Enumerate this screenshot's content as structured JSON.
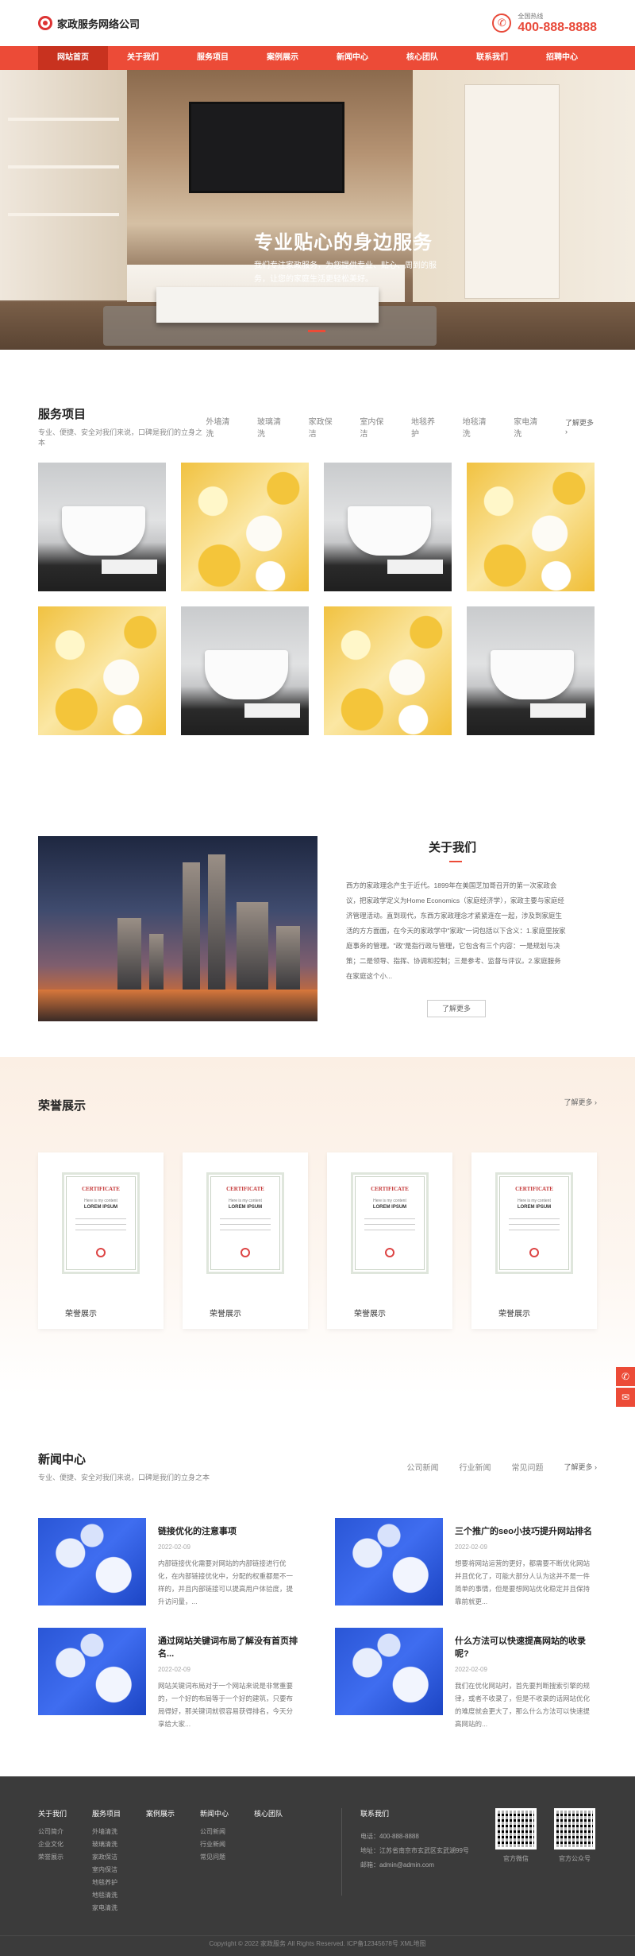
{
  "header": {
    "logo_text": "家政服务网络公司",
    "hotline_label": "全国热线",
    "hotline_number": "400-888-8888"
  },
  "nav": [
    "网站首页",
    "关于我们",
    "服务项目",
    "案例展示",
    "新闻中心",
    "核心团队",
    "联系我们",
    "招聘中心"
  ],
  "banner": {
    "title": "专业贴心的身边服务",
    "desc": "我们专注家政服务，为您提供专业、贴心、周到的服务，让您的家庭生活更轻松美好。"
  },
  "services": {
    "title": "服务项目",
    "subtitle": "专业、便捷、安全对我们来说，口碑是我们的立身之本",
    "tabs": [
      "外墙清洗",
      "玻璃清洗",
      "家政保洁",
      "室内保洁",
      "地毯养护",
      "地毯清洗",
      "家电清洗"
    ],
    "more": "了解更多 ›",
    "images": [
      "tub",
      "towel",
      "tub",
      "towel",
      "towel",
      "tub",
      "towel",
      "tub"
    ]
  },
  "about": {
    "title": "关于我们",
    "text": "西方的家政理念产生于近代。1899年在美国芝加哥召开的第一次家政会议，把家政学定义为Home Economics（家庭经济学），家政主要与家庭经济管理活动。直到现代，东西方家政理念才紧紧连在一起，涉及到家庭生活的方方面面，在今天的家政学中\"家政\"一词包括以下含义：1.家庭里按家庭事务的管理。\"政\"是指行政与管理，它包含有三个内容：一是规划与决策；二是领导、指挥、协调和控制；三是参考、监督与评议。2.家庭服务在家庭这个小...",
    "button": "了解更多"
  },
  "honor": {
    "title": "荣誉展示",
    "more": "了解更多 ›",
    "cert_title": "CERTIFICATE",
    "cert_sub": "Here is my content",
    "cert_name": "LOREM IPSUM",
    "items": [
      "荣誉展示",
      "荣誉展示",
      "荣誉展示",
      "荣誉展示"
    ]
  },
  "news": {
    "title": "新闻中心",
    "subtitle": "专业、便捷、安全对我们来说，口碑是我们的立身之本",
    "tabs": [
      "公司新闻",
      "行业新闻",
      "常见问题"
    ],
    "more": "了解更多 ›",
    "items": [
      {
        "title": "链接优化的注意事项",
        "date": "2022-02-09",
        "desc": "内部链接优化需要对网站的内部链接进行优化，在内部链接优化中，分配的权重都是不一样的，并且内部链接可以提高用户体验度，提升访问量，..."
      },
      {
        "title": "三个推广的seo小技巧提升网站排名",
        "date": "2022-02-09",
        "desc": "想要将网站运营的更好，都需要不断优化网站并且优化了，可能大部分人认为这并不是一件简单的事情，但是要想网站优化稳定并且保持靠前就更..."
      },
      {
        "title": "通过网站关键词布局了解没有首页排名...",
        "date": "2022-02-09",
        "desc": "网站关键词布局对于一个网站来说是非常重要的，一个好的布局等于一个好的建筑，只要布局得好，那关键词就很容易获得排名，今天分享给大家..."
      },
      {
        "title": "什么方法可以快速提高网站的收录呢?",
        "date": "2022-02-09",
        "desc": "我们在优化网站时，首先要判断搜索引擎的规律，或者不收录了，但是不收录的话网站优化的难度就会更大了，那么什么方法可以快速提高网站的..."
      }
    ]
  },
  "footer": {
    "cols": [
      {
        "title": "关于我们",
        "items": [
          "公司简介",
          "企业文化",
          "荣誉展示"
        ]
      },
      {
        "title": "服务项目",
        "items": [
          "外墙清洗",
          "玻璃清洗",
          "家政保洁",
          "室内保洁",
          "地毯养护",
          "地毯清洗",
          "家电清洗"
        ]
      },
      {
        "title": "案例展示",
        "items": []
      },
      {
        "title": "新闻中心",
        "items": [
          "公司新闻",
          "行业新闻",
          "常见问题"
        ]
      },
      {
        "title": "核心团队",
        "items": []
      }
    ],
    "contact_title": "联系我们",
    "contact": [
      "电话：400-888-8888",
      "地址：江苏省南京市玄武区玄武湖99号",
      "邮箱：admin@admin.com"
    ],
    "qr1": "官方微信",
    "qr2": "官方公众号",
    "copyright": "Copyright © 2022 家政服务 All Rights Reserved. ICP备12345678号 XML地图"
  },
  "colors": {
    "accent": "#ec4b37"
  }
}
